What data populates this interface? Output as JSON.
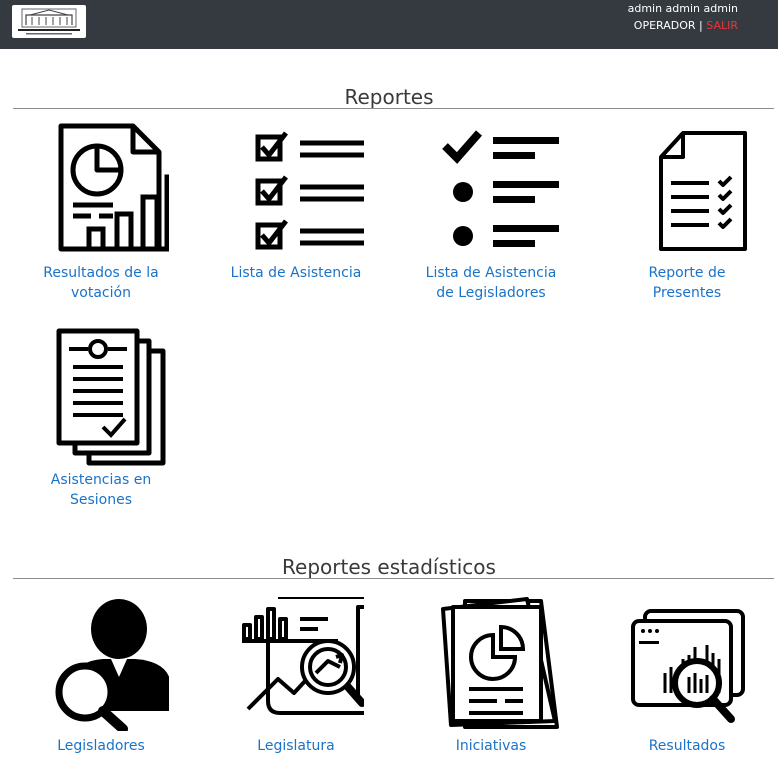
{
  "header": {
    "username": "admin admin admin",
    "role": "OPERADOR",
    "separator": "|",
    "logout": "SALIR"
  },
  "sections": {
    "reportes": {
      "title": "Reportes",
      "items": [
        {
          "label": "Resultados de la votación",
          "icon": "pie-chart-report-icon"
        },
        {
          "label": "Lista de Asistencia",
          "icon": "checklist-icon"
        },
        {
          "label": "Lista de Asistencia de Legisladores",
          "icon": "check-bullet-list-icon"
        },
        {
          "label": "Reporte de Presentes",
          "icon": "document-checklist-icon"
        },
        {
          "label": "Asistencias en Sesiones",
          "icon": "documents-stack-icon"
        }
      ]
    },
    "estadisticos": {
      "title": "Reportes estadísticos",
      "items": [
        {
          "label": "Legisladores",
          "icon": "person-search-icon"
        },
        {
          "label": "Legislatura",
          "icon": "chart-analysis-icon"
        },
        {
          "label": "Iniciativas",
          "icon": "chart-documents-icon"
        },
        {
          "label": "Resultados",
          "icon": "data-analytics-icon"
        }
      ]
    }
  }
}
